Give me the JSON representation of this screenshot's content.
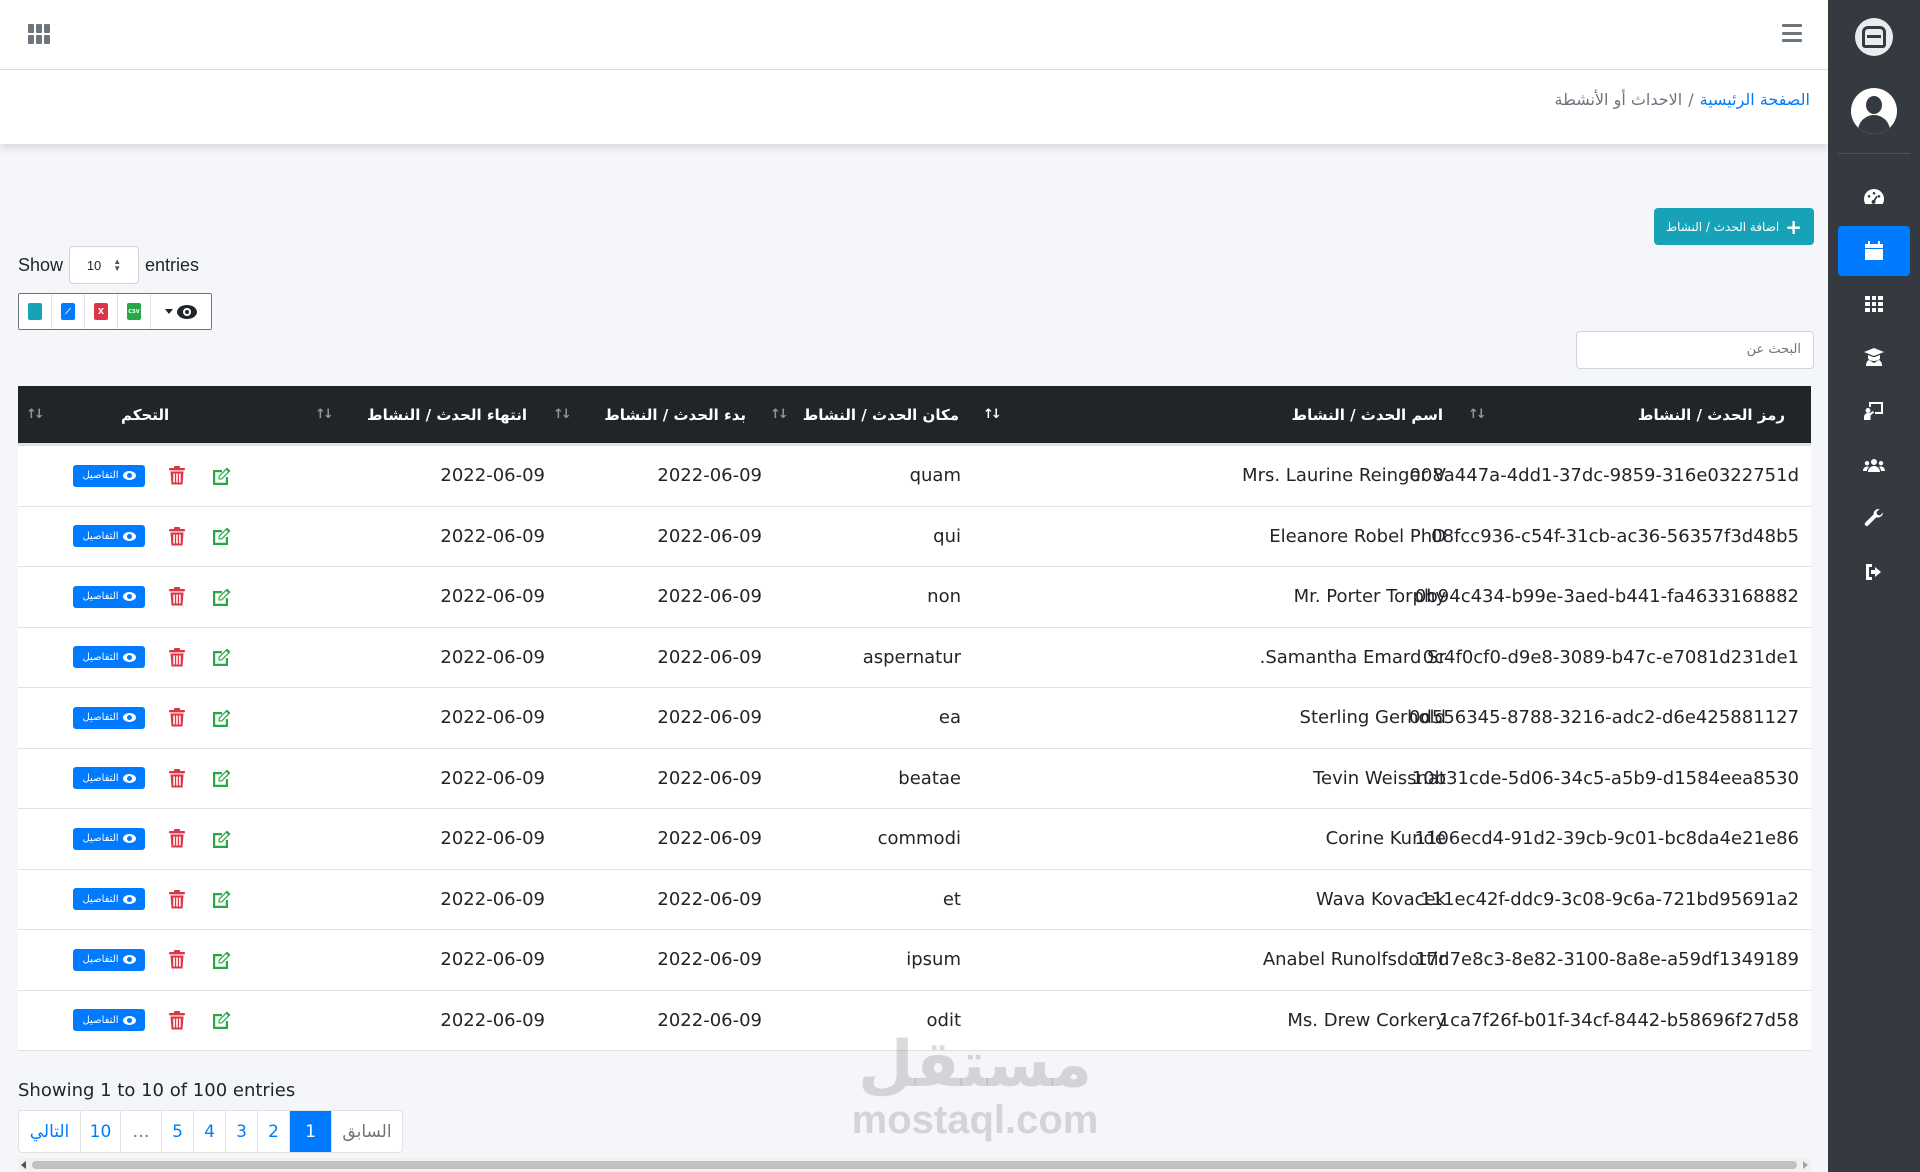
{
  "header": {
    "breadcrumb_home": "الصفحة الرئيسية",
    "breadcrumb_separator": "/",
    "breadcrumb_current": "الاحداث أو الأنشطة"
  },
  "sidebar": {
    "items": [
      {
        "icon": "tachometer-icon",
        "active": false
      },
      {
        "icon": "calendar-icon",
        "active": true
      },
      {
        "icon": "th-grid-icon",
        "active": false
      },
      {
        "icon": "graduate-icon",
        "active": false
      },
      {
        "icon": "chalkboard-teacher-icon",
        "active": false
      },
      {
        "icon": "users-icon",
        "active": false
      },
      {
        "icon": "wrench-icon",
        "active": false
      },
      {
        "icon": "sign-out-icon",
        "active": false
      }
    ]
  },
  "toolbar": {
    "add_label": "اضافة الحدث / النشاط",
    "show_label": "Show",
    "entries_label": "entries",
    "page_length": "10",
    "search_placeholder": "البحث عن",
    "export_buttons": [
      "copy-icon",
      "pdf-icon",
      "excel-icon",
      "csv-icon",
      "column-visibility-icon"
    ],
    "xls_letter": "X",
    "csv_letter": "CSV"
  },
  "table": {
    "columns": [
      "رمز الحدث / النشاط",
      "اسم الحدث / النشاط",
      "مكان الحدث / النشاط",
      "بدء الحدث / النشاط",
      "انتهاء الحدث / النشاط",
      "التحكم"
    ],
    "sort_indicator": "↓↑",
    "details_label": "التفاصيل",
    "rows": [
      {
        "code": "008a447a-4dd1-37dc-9859-316e0322751d",
        "name": "Mrs. Laurine Reinger V",
        "place": "quam",
        "start": "2022-06-09",
        "end": "2022-06-09"
      },
      {
        "code": "08fcc936-c54f-31cb-ac36-56357f3d48b5",
        "name": "Eleanore Robel PhD",
        "place": "qui",
        "start": "2022-06-09",
        "end": "2022-06-09"
      },
      {
        "code": "0b94c434-b99e-3aed-b441-fa4633168882",
        "name": "Mr. Porter Torphy",
        "place": "non",
        "start": "2022-06-09",
        "end": "2022-06-09"
      },
      {
        "code": "0c4f0cf0-d9e8-3089-b47c-e7081d231de1",
        "name": "Samantha Emard Sr.",
        "place": "aspernatur",
        "start": "2022-06-09",
        "end": "2022-06-09"
      },
      {
        "code": "0d556345-8788-3216-adc2-d6e425881127",
        "name": "Sterling Gerhold",
        "place": "ea",
        "start": "2022-06-09",
        "end": "2022-06-09"
      },
      {
        "code": "10b31cde-5d06-34c5-a5b9-d1584eea8530",
        "name": "Tevin Weissnat",
        "place": "beatae",
        "start": "2022-06-09",
        "end": "2022-06-09"
      },
      {
        "code": "1106ecd4-91d2-39cb-9c01-bc8da4e21e86",
        "name": "Corine Kunde",
        "place": "commodi",
        "start": "2022-06-09",
        "end": "2022-06-09"
      },
      {
        "code": "111ec42f-ddc9-3c08-9c6a-721bd95691a2",
        "name": "Wava Kovacek",
        "place": "et",
        "start": "2022-06-09",
        "end": "2022-06-09"
      },
      {
        "code": "17d7e8c3-8e82-3100-8a8e-a59df1349189",
        "name": "Anabel Runolfsdottir",
        "place": "ipsum",
        "start": "2022-06-09",
        "end": "2022-06-09"
      },
      {
        "code": "1ca7f26f-b01f-34cf-8442-b58696f27d58",
        "name": "Ms. Drew Corkery",
        "place": "odit",
        "start": "2022-06-09",
        "end": "2022-06-09"
      }
    ]
  },
  "footer": {
    "info": "Showing 1 to 10 of 100 entries",
    "pages": [
      {
        "label": "التالي",
        "state": "normal"
      },
      {
        "label": "10",
        "state": "normal"
      },
      {
        "label": "…",
        "state": "disabled"
      },
      {
        "label": "5",
        "state": "normal"
      },
      {
        "label": "4",
        "state": "normal"
      },
      {
        "label": "3",
        "state": "normal"
      },
      {
        "label": "2",
        "state": "normal"
      },
      {
        "label": "1",
        "state": "active"
      },
      {
        "label": "السابق",
        "state": "disabled"
      }
    ]
  },
  "watermark": {
    "arabic": "مستقل",
    "latin": "mostaql.com"
  },
  "colors": {
    "primary": "#007bff",
    "info": "#17a2b8",
    "danger": "#dc3545",
    "success": "#28a745",
    "dark": "#343a40",
    "table_head": "#212529"
  }
}
